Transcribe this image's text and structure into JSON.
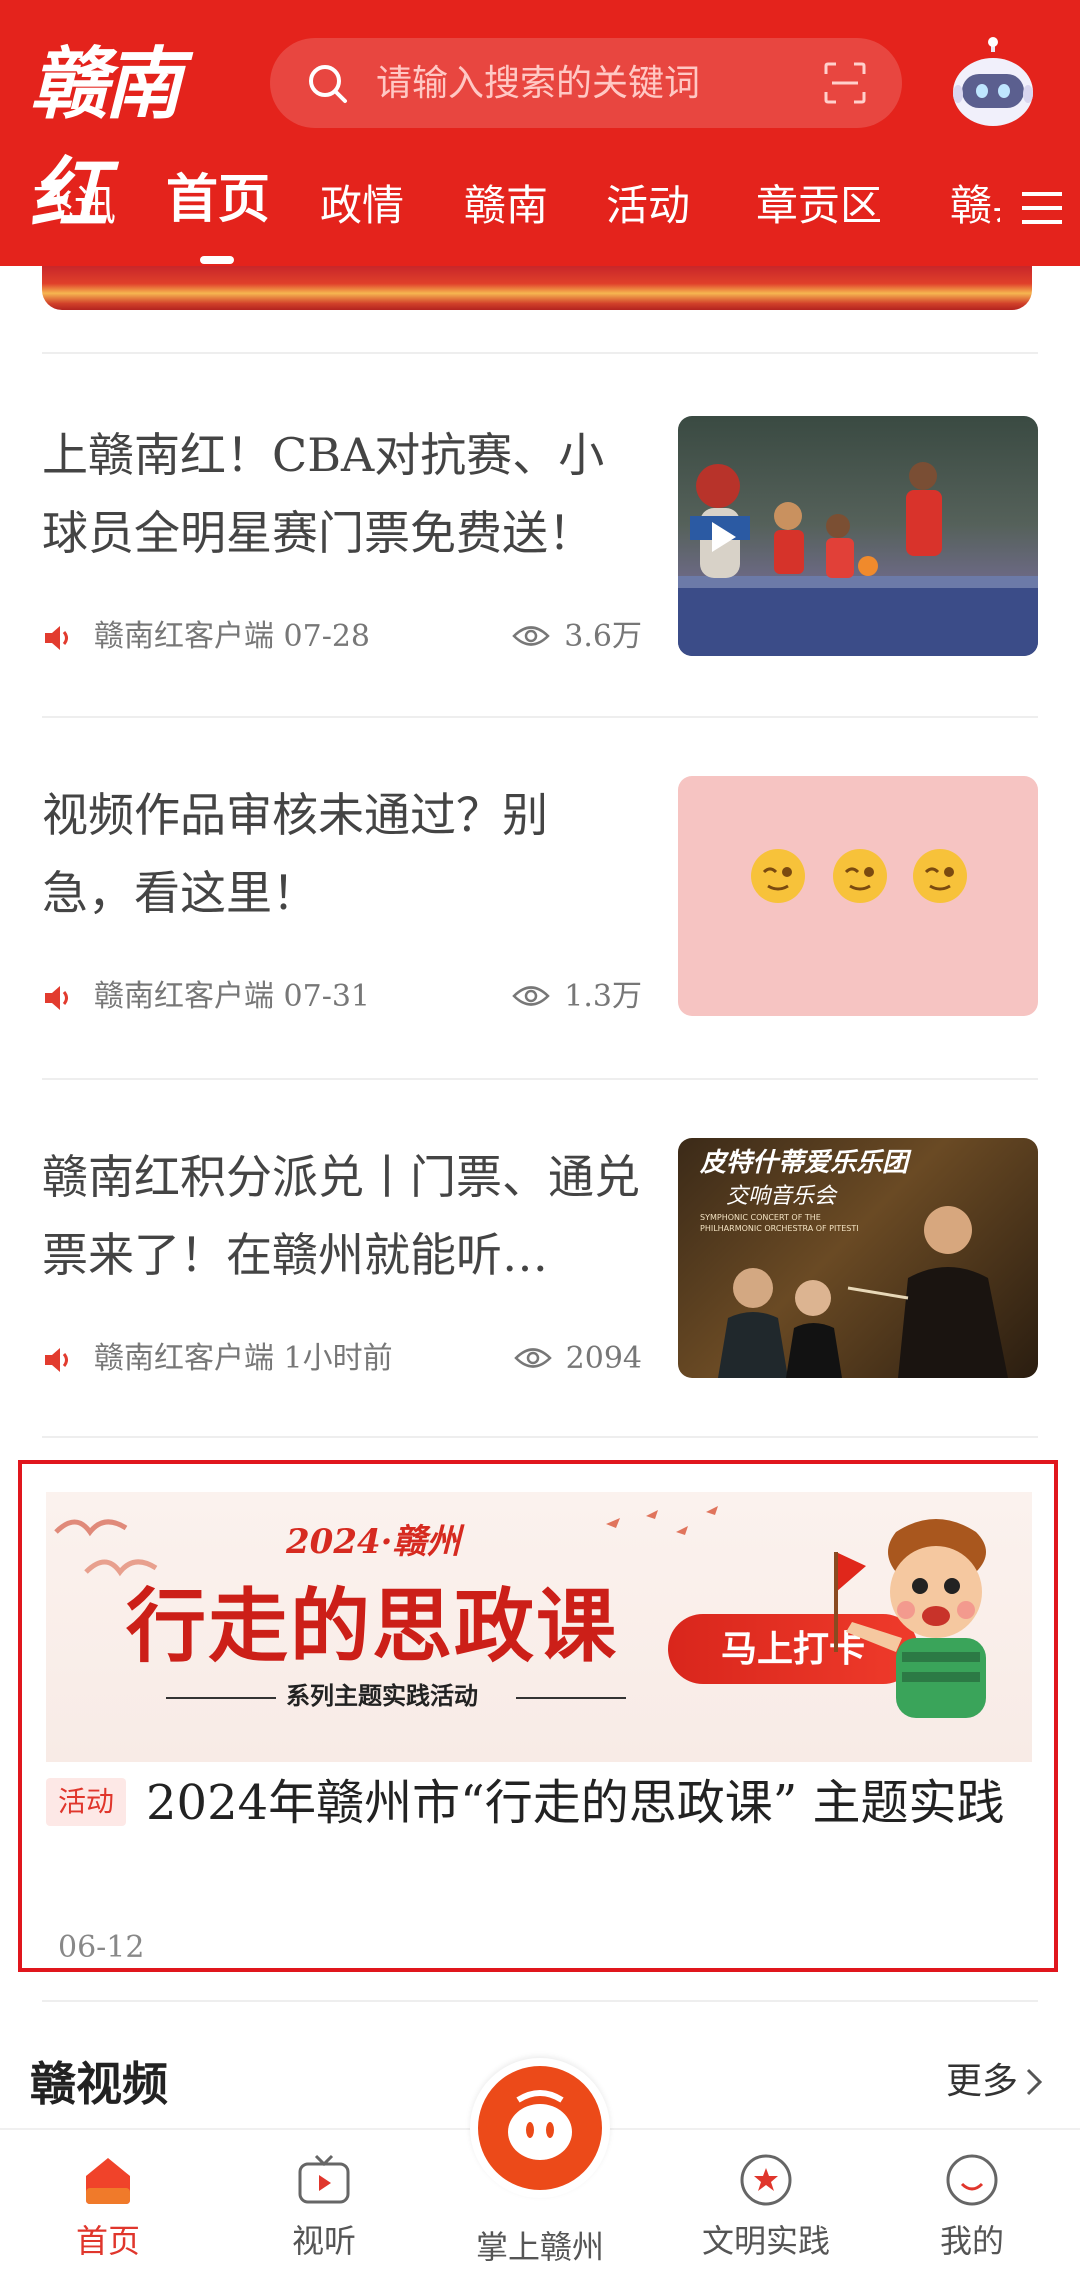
{
  "header": {
    "logo_text": "赣南红",
    "search_placeholder": "请输入搜索的关键词",
    "tabs": [
      {
        "label": "飞讯"
      },
      {
        "label": "首页",
        "active": true
      },
      {
        "label": "政情"
      },
      {
        "label": "赣南"
      },
      {
        "label": "活动"
      },
      {
        "label": "章贡区"
      },
      {
        "label": "赣县"
      }
    ],
    "colors": {
      "brand": "#e4231c"
    }
  },
  "feed": [
    {
      "title": "上赣南红！CBA对抗赛、小球员全明星赛门票免费送！",
      "source": "赣南红客户端 07-28",
      "views": "3.6万",
      "thumb": "basketball-video-thumbnail",
      "is_video": true
    },
    {
      "title": "视频作品审核未通过？别急，看这里！",
      "source": "赣南红客户端 07-31",
      "views": "1.3万",
      "thumb": "emoji-thumbnail",
      "emoji": [
        "🤨",
        "🤨",
        "🤨"
      ]
    },
    {
      "title": "赣南红积分派兑丨门票、通兑票来了！在赣州就能听…",
      "source": "赣南红客户端 1小时前",
      "views": "2094",
      "thumb": "concert-thumbnail",
      "thumb_title": "皮特什蒂爱乐乐团",
      "thumb_subtitle": "交响音乐会",
      "thumb_en": "SYMPHONIC CONCERT OF THE PHILHARMONIC ORCHESTRA OF PITESTI"
    }
  ],
  "activity": {
    "banner_year": "2024·赣州",
    "banner_title": "行走的思政课",
    "banner_subtitle": "系列主题实践活动",
    "banner_button": "马上打卡",
    "tag": "活动",
    "title": "2024年赣州市“行走的思政课” 主题实践",
    "date": "06-12"
  },
  "section": {
    "title": "赣视频",
    "more": "更多"
  },
  "bottom_nav": {
    "items": [
      {
        "label": "首页",
        "active": true
      },
      {
        "label": "视听"
      },
      {
        "label": "掌上赣州"
      },
      {
        "label": "文明实践"
      },
      {
        "label": "我的"
      }
    ]
  }
}
